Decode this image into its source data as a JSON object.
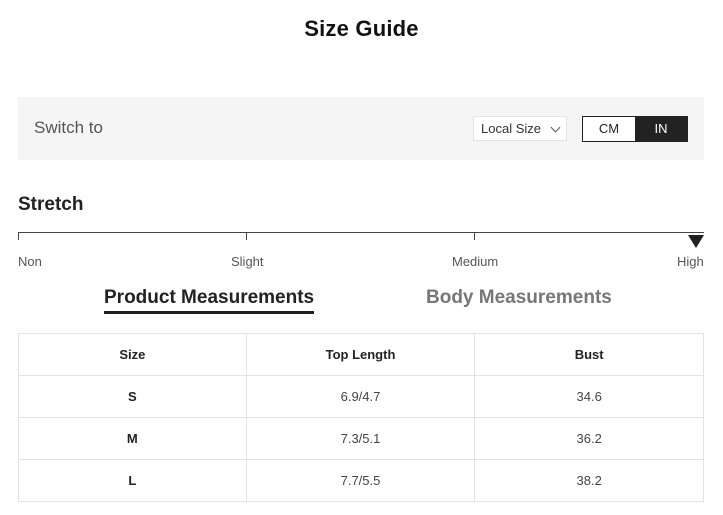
{
  "page": {
    "title": "Size Guide"
  },
  "switch_bar": {
    "label": "Switch to",
    "size_select": {
      "selected": "Local Size"
    },
    "units": [
      {
        "label": "CM",
        "active": false
      },
      {
        "label": "IN",
        "active": true
      }
    ]
  },
  "stretch": {
    "title": "Stretch",
    "levels": [
      "Non",
      "Slight",
      "Medium",
      "High"
    ],
    "selected": "High"
  },
  "tabs": [
    {
      "label": "Product Measurements",
      "active": true
    },
    {
      "label": "Body Measurements",
      "active": false
    }
  ],
  "table": {
    "headers": [
      "Size",
      "Top Length",
      "Bust"
    ],
    "rows": [
      [
        "S",
        "6.9/4.7",
        "34.6"
      ],
      [
        "M",
        "7.3/5.1",
        "36.2"
      ],
      [
        "L",
        "7.7/5.5",
        "38.2"
      ]
    ]
  },
  "colors": {
    "accent": "#222222",
    "panel_bg": "#f5f5f5",
    "border": "#e3e3e3"
  }
}
